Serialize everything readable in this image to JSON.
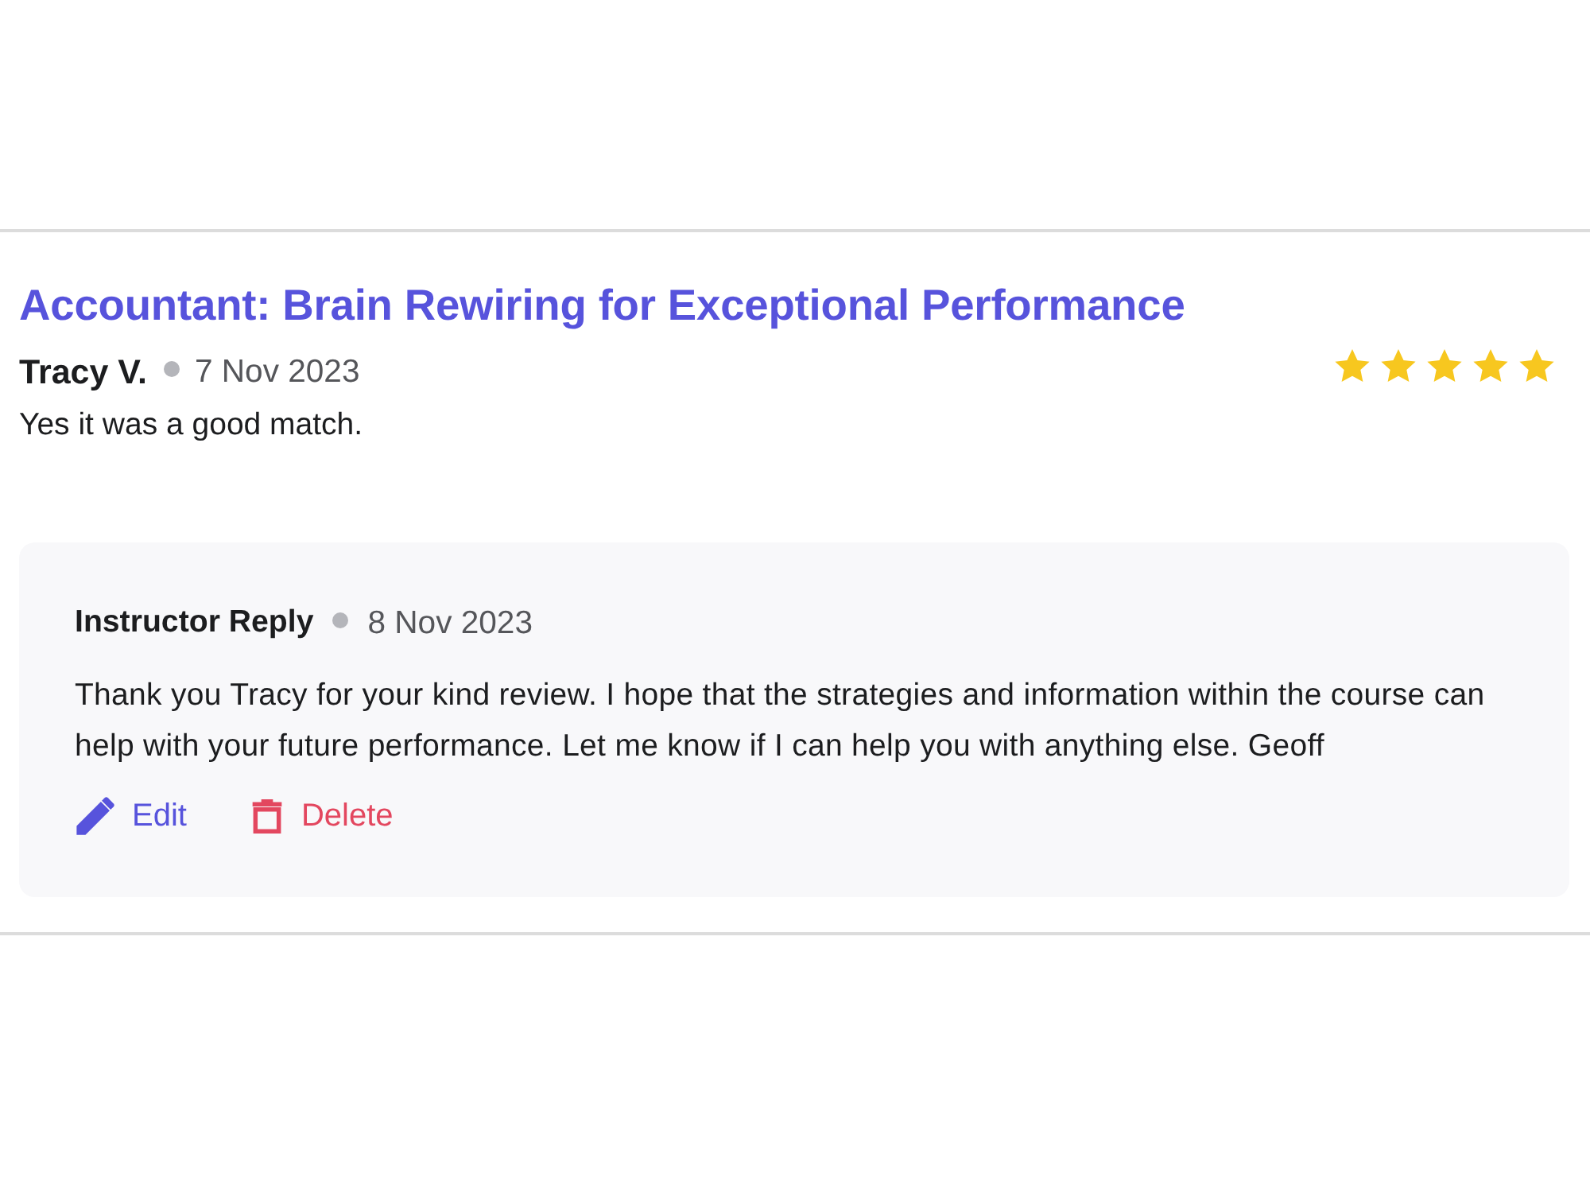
{
  "review": {
    "course_title": "Accountant: Brain Rewiring for Exceptional Performance",
    "author": "Tracy V.",
    "date": "7 Nov 2023",
    "stars": 5,
    "text": "Yes it was a good match."
  },
  "reply": {
    "label": "Instructor Reply",
    "date": "8 Nov 2023",
    "text": "Thank you Tracy for your kind review. I hope that the strategies and information within the course can help with your future performance. Let me know if I can help you with anything else. Geoff",
    "actions": [
      {
        "kind": "edit",
        "label": "Edit"
      },
      {
        "kind": "delete",
        "label": "Delete"
      }
    ]
  }
}
